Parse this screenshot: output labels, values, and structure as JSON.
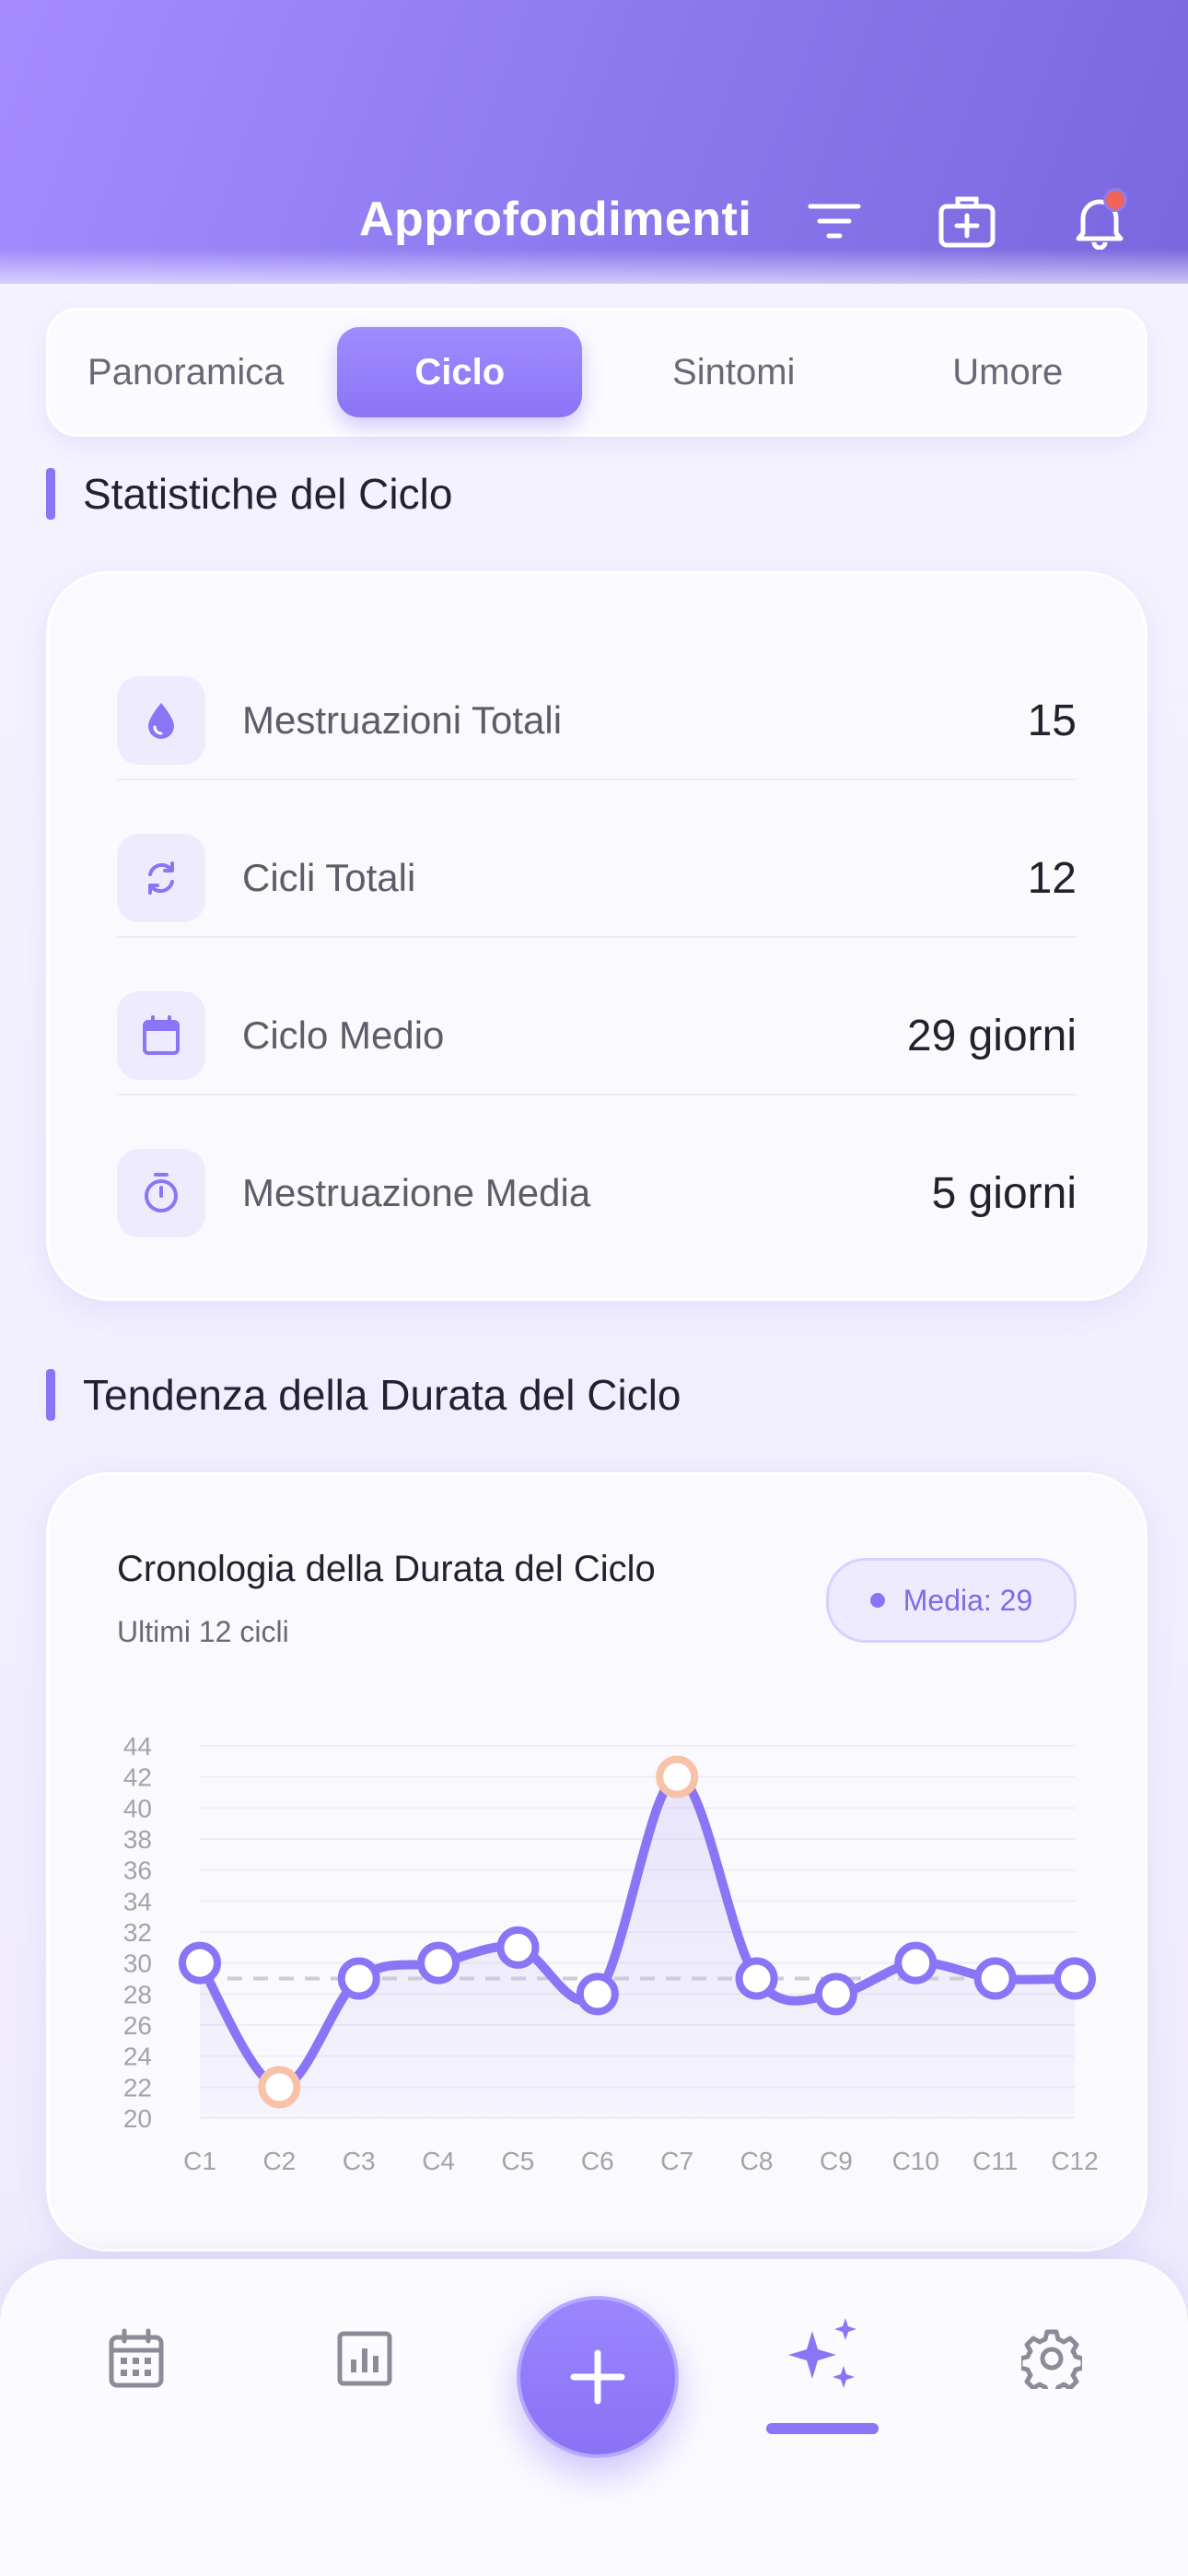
{
  "header": {
    "title": "Approfondimenti",
    "icons": [
      "filter-icon",
      "first-aid-kit-icon",
      "bell-icon"
    ]
  },
  "tabs": [
    {
      "label": "Panoramica",
      "active": false
    },
    {
      "label": "Ciclo",
      "active": true
    },
    {
      "label": "Sintomi",
      "active": false
    },
    {
      "label": "Umore",
      "active": false
    }
  ],
  "stats_section": {
    "title": "Statistiche del Ciclo",
    "rows": [
      {
        "icon": "drop-icon",
        "label": "Mestruazioni Totali",
        "value": "15"
      },
      {
        "icon": "cycle-icon",
        "label": "Cicli Totali",
        "value": "12"
      },
      {
        "icon": "calendar-icon",
        "label": "Ciclo Medio",
        "value": "29 giorni"
      },
      {
        "icon": "stopwatch-icon",
        "label": "Mestruazione Media",
        "value": "5 giorni"
      }
    ]
  },
  "trend_section": {
    "title": "Tendenza della Durata del Ciclo",
    "card_title": "Cronologia della Durata del Ciclo",
    "card_subtitle": "Ultimi 12 cicli",
    "average_badge": "Media: 29"
  },
  "chart_data": {
    "type": "line",
    "categories": [
      "C1",
      "C2",
      "C3",
      "C4",
      "C5",
      "C6",
      "C7",
      "C8",
      "C9",
      "C10",
      "C11",
      "C12"
    ],
    "values": [
      30,
      22,
      29,
      30,
      31,
      28,
      42,
      29,
      28,
      30,
      29,
      29
    ],
    "average": 29,
    "ylim": [
      20,
      44
    ],
    "yticks": [
      "20",
      "22",
      "24",
      "26",
      "28",
      "30",
      "32",
      "34",
      "36",
      "38",
      "40",
      "42",
      "44"
    ],
    "highlighted_points": [
      "C2",
      "C7"
    ],
    "grid": true,
    "colors": {
      "line": "#8b74f6",
      "highlight": "#f7c2a8",
      "average_line": "#cfcbd8"
    }
  },
  "bottom_nav": {
    "items": [
      "calendar-icon",
      "chart-icon",
      "add-icon",
      "sparkles-icon",
      "gear-icon"
    ],
    "active": "sparkles-icon"
  },
  "colors": {
    "accent": "#8b74f6",
    "header_start": "#a48cff",
    "header_end": "#7a67de",
    "notification": "#f0645a"
  }
}
